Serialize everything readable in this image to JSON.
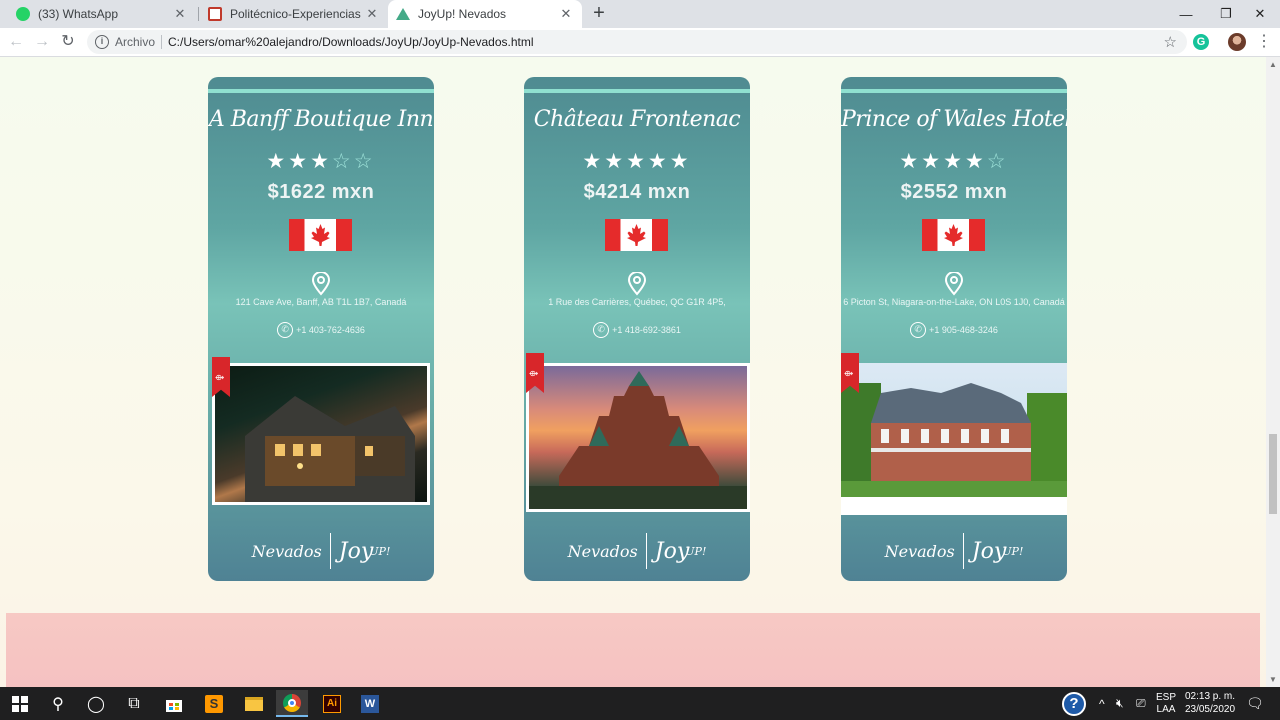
{
  "browser": {
    "tabs": [
      {
        "title": "(33) WhatsApp",
        "icon": "whatsapp-icon",
        "color": "#25d366",
        "active": false
      },
      {
        "title": "Politécnico-Experiencias",
        "icon": "politecnico-icon",
        "color": "#c0392b",
        "active": false
      },
      {
        "title": "JoyUp! Nevados",
        "icon": "mountain-icon",
        "color": "#4a8",
        "active": true
      }
    ],
    "address_scheme": "Archivo",
    "address_url": "C:/Users/omar%20alejandro/Downloads/JoyUp/JoyUp-Nevados.html",
    "extension_letter": "G"
  },
  "hotels": [
    {
      "name": "A Banff Boutique Inn",
      "stars": 3,
      "max_stars": 5,
      "price": "$1622 mxn",
      "address": "121 Cave Ave, Banff, AB T1L 1B7, Canadá",
      "phone": "+1 403-762-4636"
    },
    {
      "name": "Château Frontenac",
      "stars": 5,
      "max_stars": 5,
      "price": "$4214 mxn",
      "address": "1 Rue des Carrières, Québec, QC G1R 4P5,",
      "phone": "+1 418-692-3861"
    },
    {
      "name": "Prince of Wales Hotel",
      "stars": 4,
      "max_stars": 5,
      "price": "$2552 mxn",
      "address": "6 Picton St, Niagara-on-the-Lake, ON L0S 1J0, Canadá",
      "phone": "+1 905-468-3246"
    }
  ],
  "footer": {
    "brand1": "Nevados",
    "brand2": "Joy",
    "brand2_sup": "UP!"
  },
  "taskbar": {
    "lang_top": "ESP",
    "lang_bottom": "LAA",
    "time": "02:13 p. m.",
    "date": "23/05/2020"
  }
}
